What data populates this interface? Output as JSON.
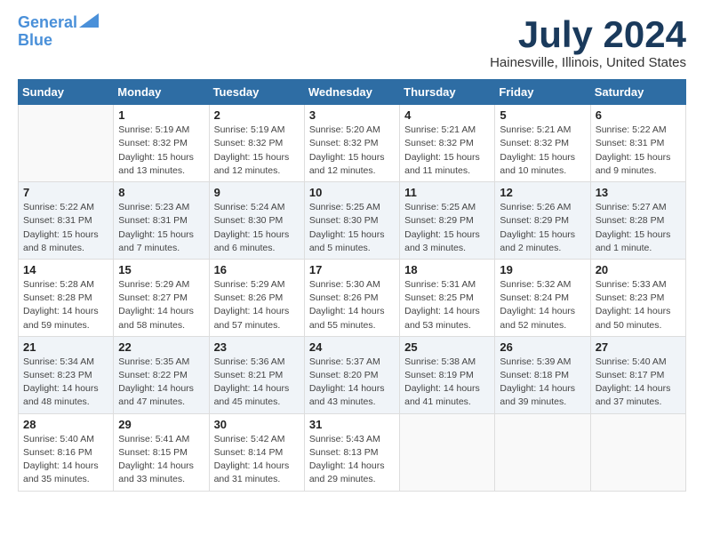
{
  "header": {
    "logo_line1": "General",
    "logo_line2": "Blue",
    "month": "July 2024",
    "location": "Hainesville, Illinois, United States"
  },
  "weekdays": [
    "Sunday",
    "Monday",
    "Tuesday",
    "Wednesday",
    "Thursday",
    "Friday",
    "Saturday"
  ],
  "weeks": [
    [
      {
        "day": "",
        "info": ""
      },
      {
        "day": "1",
        "info": "Sunrise: 5:19 AM\nSunset: 8:32 PM\nDaylight: 15 hours\nand 13 minutes."
      },
      {
        "day": "2",
        "info": "Sunrise: 5:19 AM\nSunset: 8:32 PM\nDaylight: 15 hours\nand 12 minutes."
      },
      {
        "day": "3",
        "info": "Sunrise: 5:20 AM\nSunset: 8:32 PM\nDaylight: 15 hours\nand 12 minutes."
      },
      {
        "day": "4",
        "info": "Sunrise: 5:21 AM\nSunset: 8:32 PM\nDaylight: 15 hours\nand 11 minutes."
      },
      {
        "day": "5",
        "info": "Sunrise: 5:21 AM\nSunset: 8:32 PM\nDaylight: 15 hours\nand 10 minutes."
      },
      {
        "day": "6",
        "info": "Sunrise: 5:22 AM\nSunset: 8:31 PM\nDaylight: 15 hours\nand 9 minutes."
      }
    ],
    [
      {
        "day": "7",
        "info": "Sunrise: 5:22 AM\nSunset: 8:31 PM\nDaylight: 15 hours\nand 8 minutes."
      },
      {
        "day": "8",
        "info": "Sunrise: 5:23 AM\nSunset: 8:31 PM\nDaylight: 15 hours\nand 7 minutes."
      },
      {
        "day": "9",
        "info": "Sunrise: 5:24 AM\nSunset: 8:30 PM\nDaylight: 15 hours\nand 6 minutes."
      },
      {
        "day": "10",
        "info": "Sunrise: 5:25 AM\nSunset: 8:30 PM\nDaylight: 15 hours\nand 5 minutes."
      },
      {
        "day": "11",
        "info": "Sunrise: 5:25 AM\nSunset: 8:29 PM\nDaylight: 15 hours\nand 3 minutes."
      },
      {
        "day": "12",
        "info": "Sunrise: 5:26 AM\nSunset: 8:29 PM\nDaylight: 15 hours\nand 2 minutes."
      },
      {
        "day": "13",
        "info": "Sunrise: 5:27 AM\nSunset: 8:28 PM\nDaylight: 15 hours\nand 1 minute."
      }
    ],
    [
      {
        "day": "14",
        "info": "Sunrise: 5:28 AM\nSunset: 8:28 PM\nDaylight: 14 hours\nand 59 minutes."
      },
      {
        "day": "15",
        "info": "Sunrise: 5:29 AM\nSunset: 8:27 PM\nDaylight: 14 hours\nand 58 minutes."
      },
      {
        "day": "16",
        "info": "Sunrise: 5:29 AM\nSunset: 8:26 PM\nDaylight: 14 hours\nand 57 minutes."
      },
      {
        "day": "17",
        "info": "Sunrise: 5:30 AM\nSunset: 8:26 PM\nDaylight: 14 hours\nand 55 minutes."
      },
      {
        "day": "18",
        "info": "Sunrise: 5:31 AM\nSunset: 8:25 PM\nDaylight: 14 hours\nand 53 minutes."
      },
      {
        "day": "19",
        "info": "Sunrise: 5:32 AM\nSunset: 8:24 PM\nDaylight: 14 hours\nand 52 minutes."
      },
      {
        "day": "20",
        "info": "Sunrise: 5:33 AM\nSunset: 8:23 PM\nDaylight: 14 hours\nand 50 minutes."
      }
    ],
    [
      {
        "day": "21",
        "info": "Sunrise: 5:34 AM\nSunset: 8:23 PM\nDaylight: 14 hours\nand 48 minutes."
      },
      {
        "day": "22",
        "info": "Sunrise: 5:35 AM\nSunset: 8:22 PM\nDaylight: 14 hours\nand 47 minutes."
      },
      {
        "day": "23",
        "info": "Sunrise: 5:36 AM\nSunset: 8:21 PM\nDaylight: 14 hours\nand 45 minutes."
      },
      {
        "day": "24",
        "info": "Sunrise: 5:37 AM\nSunset: 8:20 PM\nDaylight: 14 hours\nand 43 minutes."
      },
      {
        "day": "25",
        "info": "Sunrise: 5:38 AM\nSunset: 8:19 PM\nDaylight: 14 hours\nand 41 minutes."
      },
      {
        "day": "26",
        "info": "Sunrise: 5:39 AM\nSunset: 8:18 PM\nDaylight: 14 hours\nand 39 minutes."
      },
      {
        "day": "27",
        "info": "Sunrise: 5:40 AM\nSunset: 8:17 PM\nDaylight: 14 hours\nand 37 minutes."
      }
    ],
    [
      {
        "day": "28",
        "info": "Sunrise: 5:40 AM\nSunset: 8:16 PM\nDaylight: 14 hours\nand 35 minutes."
      },
      {
        "day": "29",
        "info": "Sunrise: 5:41 AM\nSunset: 8:15 PM\nDaylight: 14 hours\nand 33 minutes."
      },
      {
        "day": "30",
        "info": "Sunrise: 5:42 AM\nSunset: 8:14 PM\nDaylight: 14 hours\nand 31 minutes."
      },
      {
        "day": "31",
        "info": "Sunrise: 5:43 AM\nSunset: 8:13 PM\nDaylight: 14 hours\nand 29 minutes."
      },
      {
        "day": "",
        "info": ""
      },
      {
        "day": "",
        "info": ""
      },
      {
        "day": "",
        "info": ""
      }
    ]
  ]
}
